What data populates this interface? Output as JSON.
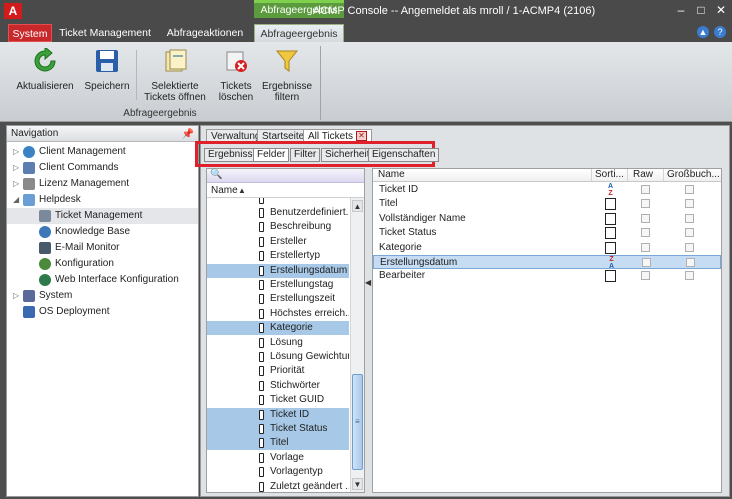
{
  "window": {
    "app_logo": "A",
    "context_tab": "Abfrageergebnis",
    "title": "ACMP Console -- Angemeldet als mroll / 1-ACMP4 (2106)",
    "controls": [
      "–",
      "□",
      "✕"
    ],
    "help_icons": [
      "▲",
      "?"
    ]
  },
  "ribbon": {
    "tabs": [
      "System",
      "Ticket Management",
      "Abfrageaktionen",
      "Abfrageergebnis"
    ],
    "buttons": [
      {
        "label1": "Aktualisieren",
        "label2": "",
        "icon": "refresh-icon"
      },
      {
        "label1": "Speichern",
        "label2": "",
        "icon": "save-icon"
      },
      {
        "label1": "Selektierte",
        "label2": "Tickets öffnen",
        "icon": "open-tickets-icon"
      },
      {
        "label1": "Tickets",
        "label2": "löschen",
        "icon": "delete-tickets-icon"
      },
      {
        "label1": "Ergebnisse",
        "label2": "filtern",
        "icon": "filter-icon"
      }
    ],
    "group_label": "Abfrageergebnis"
  },
  "navigation": {
    "title": "Navigation",
    "items": [
      {
        "label": "Client Management",
        "expander": "▷",
        "icon_color": "#3b82c4"
      },
      {
        "label": "Client Commands",
        "expander": "▷",
        "icon_color": "#5a7fb0"
      },
      {
        "label": "Lizenz Management",
        "expander": "▷",
        "icon_color": "#8a8a8a"
      },
      {
        "label": "Helpdesk",
        "expander": "◢",
        "icon_color": "#6a9fd6"
      },
      {
        "label": "Ticket Management",
        "expander": "",
        "icon_color": "#7a8a9a"
      },
      {
        "label": "Knowledge Base",
        "expander": "",
        "icon_color": "#3c78b8"
      },
      {
        "label": "E-Mail Monitor",
        "expander": "",
        "icon_color": "#4a5a6a"
      },
      {
        "label": "Konfiguration",
        "expander": "",
        "icon_color": "#4a8a3a"
      },
      {
        "label": "Web Interface Konfiguration",
        "expander": "",
        "icon_color": "#2f7a4a"
      },
      {
        "label": "System",
        "expander": "▷",
        "icon_color": "#5a6a9a"
      },
      {
        "label": "OS Deployment",
        "expander": "",
        "icon_color": "#3a6ab0"
      }
    ]
  },
  "doc_tabs": [
    "Verwaltung",
    "Startseite",
    "All Tickets"
  ],
  "sub_tabs": [
    "Ergebnisse",
    "Felder",
    "Filter",
    "Sicherheit",
    "Eigenschaften"
  ],
  "left_list": {
    "header": "Name",
    "rows": [
      {
        "label": "Benutzerdefiniert...",
        "selected": false
      },
      {
        "label": "Beschreibung",
        "selected": false
      },
      {
        "label": "Ersteller",
        "selected": false
      },
      {
        "label": "Erstellertyp",
        "selected": false
      },
      {
        "label": "Erstellungsdatum",
        "selected": true
      },
      {
        "label": "Erstellungstag",
        "selected": false
      },
      {
        "label": "Erstellungszeit",
        "selected": false
      },
      {
        "label": "Höchstes erreich...",
        "selected": false
      },
      {
        "label": "Kategorie",
        "selected": true
      },
      {
        "label": "Lösung",
        "selected": false
      },
      {
        "label": "Lösung Gewichtung",
        "selected": false
      },
      {
        "label": "Priorität",
        "selected": false
      },
      {
        "label": "Stichwörter",
        "selected": false
      },
      {
        "label": "Ticket GUID",
        "selected": false
      },
      {
        "label": "Ticket ID",
        "selected": true
      },
      {
        "label": "Ticket Status",
        "selected": true
      },
      {
        "label": "Titel",
        "selected": true
      },
      {
        "label": "Vorlage",
        "selected": false
      },
      {
        "label": "Vorlagentyp",
        "selected": false
      },
      {
        "label": "Zuletzt geändert ...",
        "selected": false
      }
    ]
  },
  "right_grid": {
    "headers": [
      "Name",
      "Sorti...",
      "Raw",
      "Großbuch..."
    ],
    "rows": [
      {
        "name": "Ticket ID",
        "sort": "asc"
      },
      {
        "name": "Titel",
        "sort": ""
      },
      {
        "name": "Vollständiger Name",
        "sort": ""
      },
      {
        "name": "Ticket Status",
        "sort": ""
      },
      {
        "name": "Kategorie",
        "sort": ""
      },
      {
        "name": "Erstellungsdatum",
        "sort": "desc"
      },
      {
        "name": "Bearbeiter",
        "sort": ""
      }
    ]
  }
}
